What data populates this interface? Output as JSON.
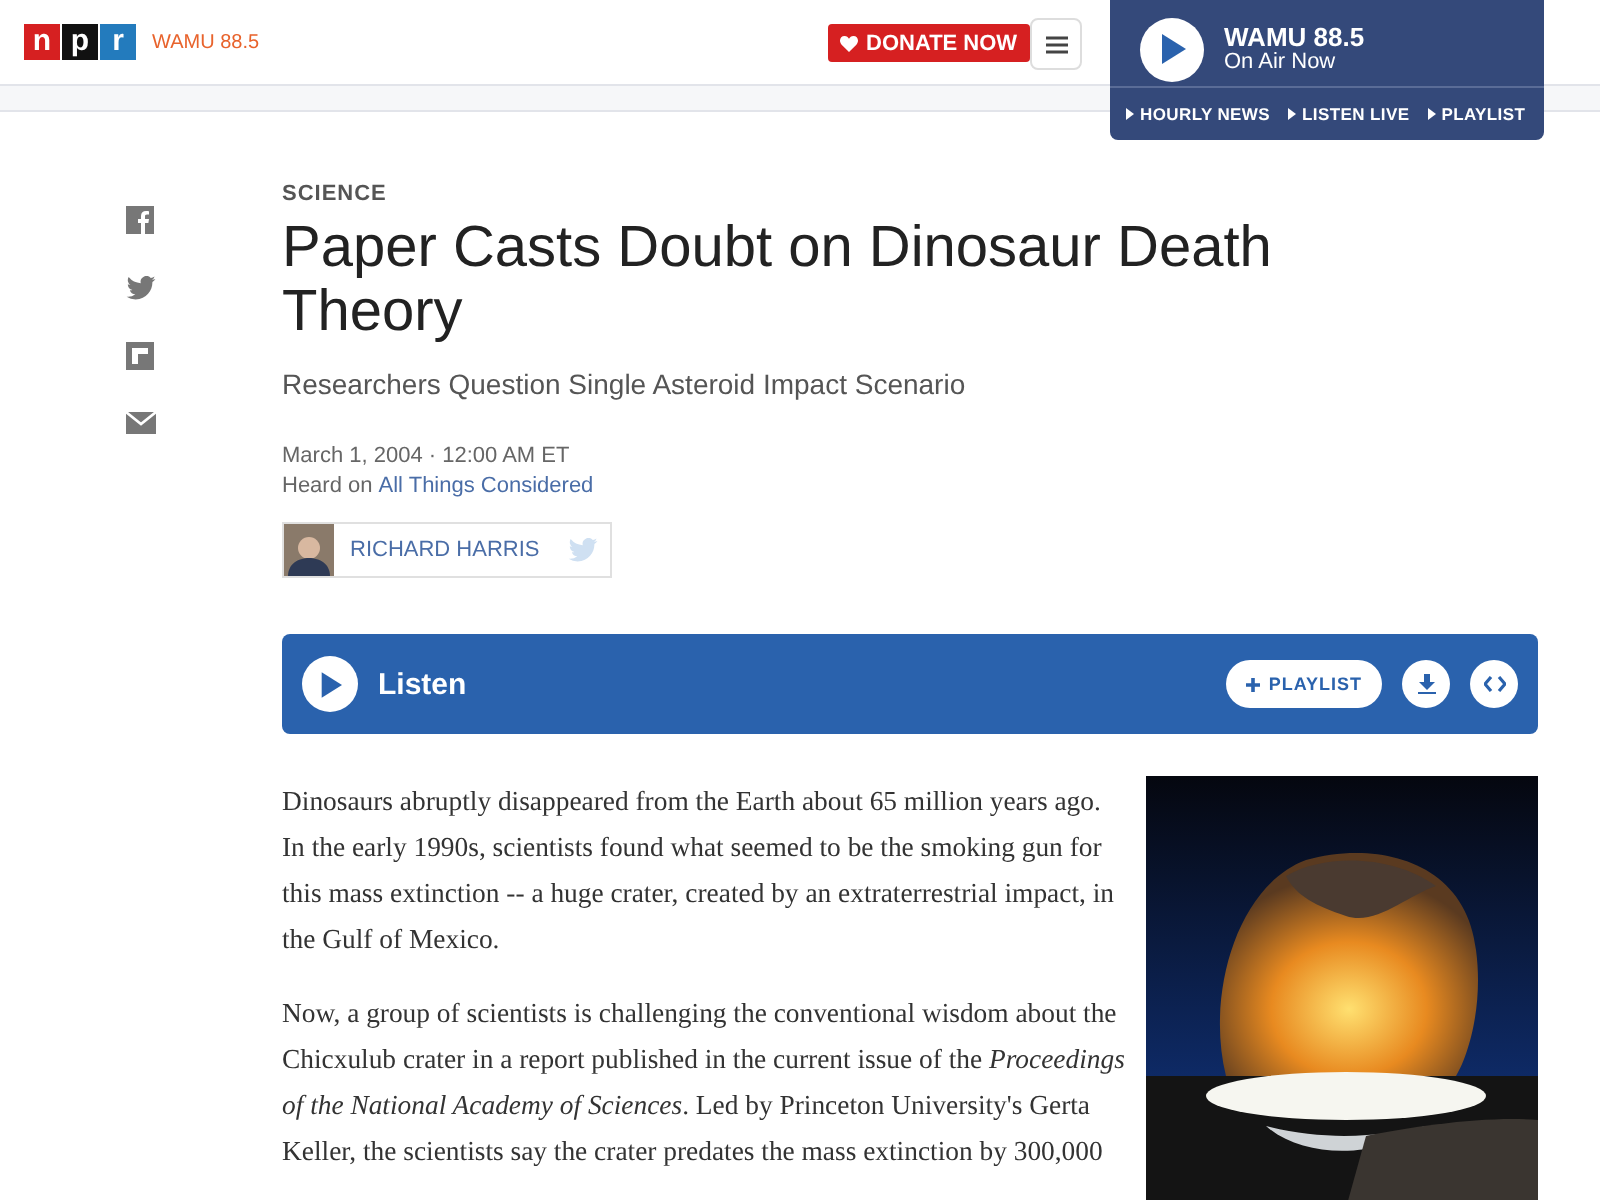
{
  "header": {
    "logo_letters": [
      "n",
      "p",
      "r"
    ],
    "station_logo": "WAMU 88.5",
    "donate": "DONATE NOW"
  },
  "player": {
    "station": "WAMU 88.5",
    "status": "On Air Now",
    "links": [
      "HOURLY NEWS",
      "LISTEN LIVE",
      "PLAYLIST"
    ]
  },
  "share": [
    {
      "kind": "facebook"
    },
    {
      "kind": "twitter"
    },
    {
      "kind": "flipboard"
    },
    {
      "kind": "email"
    }
  ],
  "article": {
    "section": "SCIENCE",
    "title": "Paper Casts Doubt on Dinosaur Death Theory",
    "subtitle": "Researchers Question Single Asteroid Impact Scenario",
    "date": "March 1, 2004 · 12:00 AM ET",
    "heard_on": "Heard on",
    "program": "All Things Considered",
    "author": "RICHARD HARRIS"
  },
  "listen_bar": {
    "label": "Listen",
    "playlist": "PLAYLIST"
  },
  "paragraphs": [
    "Dinosaurs abruptly disappeared from the Earth about 65 million years ago. In the early 1990s, scientists found what seemed to be the smoking gun for this mass extinction -- a huge crater, created by an extraterrestrial impact, in the Gulf of Mexico.",
    "Now, a group of scientists is challenging the conventional wisdom about the Chicxulub crater in a report published in the current issue of the *Proceedings of the National Academy of Sciences*. Led by Princeton University's Gerta Keller, the scientists say the crater predates the mass extinction by 300,000"
  ],
  "image": {
    "kind": "picture"
  }
}
